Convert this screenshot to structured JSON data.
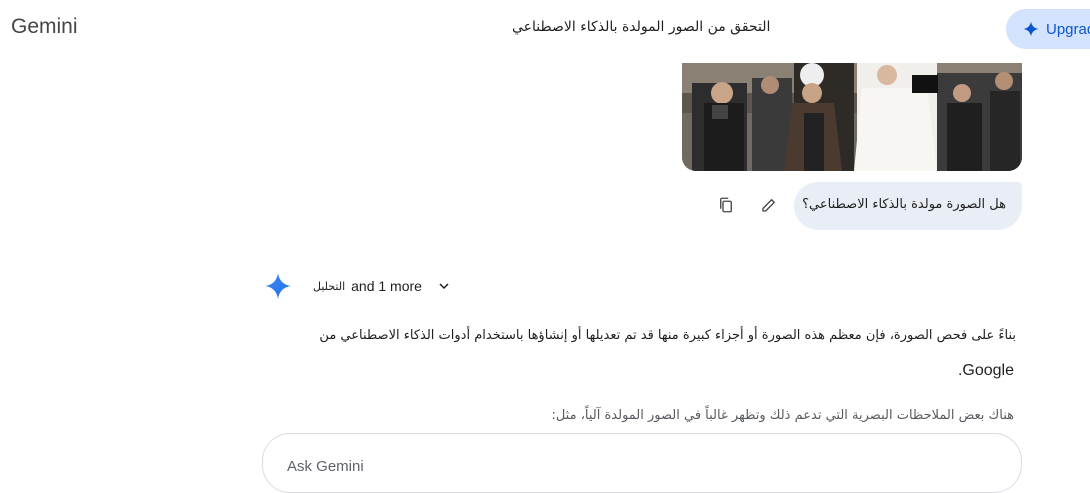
{
  "header": {
    "logo": "Gemini",
    "title": "التحقق من الصور المولدة بالذكاء الاصطناعي",
    "upgrade_label": "Upgrade"
  },
  "user_message": {
    "text": "هل الصورة مولدة بالذكاء الاصطناعي؟",
    "actions": [
      "copy-icon",
      "edit-icon"
    ]
  },
  "response": {
    "tools_label": "التحليل",
    "tools_more": "and 1 more",
    "paragraph_1": "بناءً على فحص الصورة، فإن معظم هذه الصورة أو أجزاء كبيرة منها قد تم تعديلها أو إنشاؤها باستخدام أدوات الذكاء الاصطناعي من",
    "paragraph_2": "Google.",
    "paragraph_3": "هناك بعض الملاحظات البصرية التي تدعم ذلك وتظهر غالباً في الصور المولدة آلياً، مثل:"
  },
  "input": {
    "placeholder": "Ask Gemini"
  },
  "colors": {
    "accent": "#0b57d0",
    "bubble": "#e9eef6",
    "upgrade_bg": "#d3e3fd"
  }
}
